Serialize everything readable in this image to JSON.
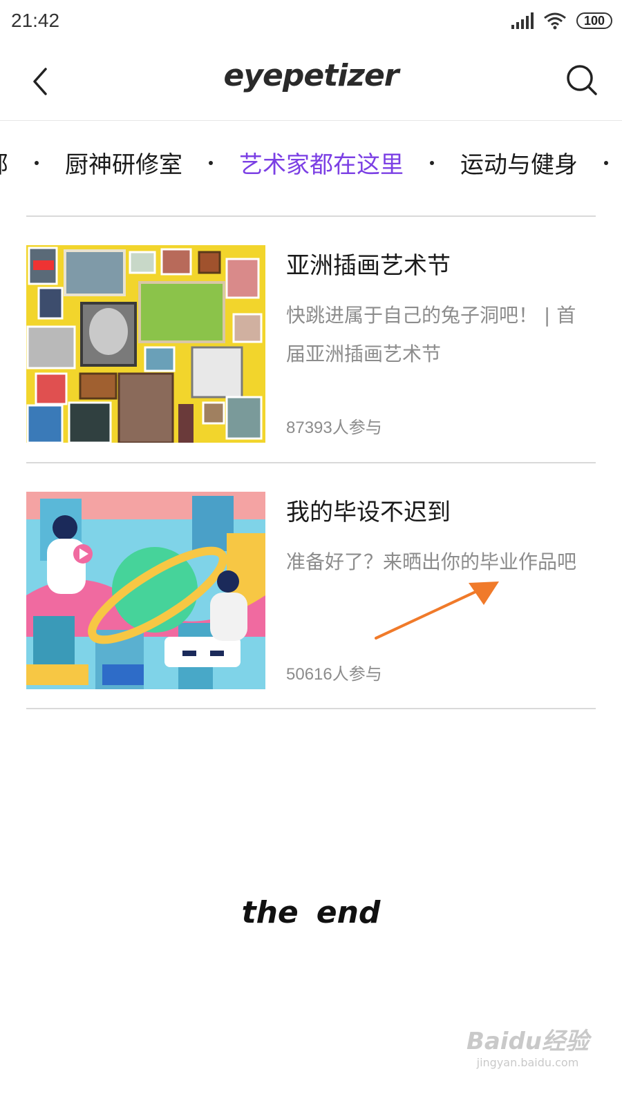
{
  "status": {
    "time": "21:42",
    "battery": "100"
  },
  "header": {
    "title": "eyepetizer",
    "back_icon": "chevron-left-icon",
    "search_icon": "search-icon"
  },
  "tabs": [
    {
      "label": "部"
    },
    {
      "label": "厨神研修室"
    },
    {
      "label": "艺术家都在这里",
      "active": true
    },
    {
      "label": "运动与健身"
    }
  ],
  "items": [
    {
      "title": "亚洲插画艺术节",
      "description": "快跳进属于自己的兔子洞吧！ | 首届亚洲插画艺术节",
      "participants": "87393",
      "participants_suffix": "人参与"
    },
    {
      "title": "我的毕设不迟到",
      "description": "准备好了？来晒出你的毕业作品吧",
      "participants": "50616",
      "participants_suffix": "人参与"
    }
  ],
  "footer": {
    "end_left": "the",
    "end_right": "end"
  },
  "colors": {
    "accent": "#7b3fe4",
    "annotation": "#f07a2a"
  },
  "watermark": {
    "main": "Baidu经验",
    "sub": "jingyan.baidu.com"
  }
}
